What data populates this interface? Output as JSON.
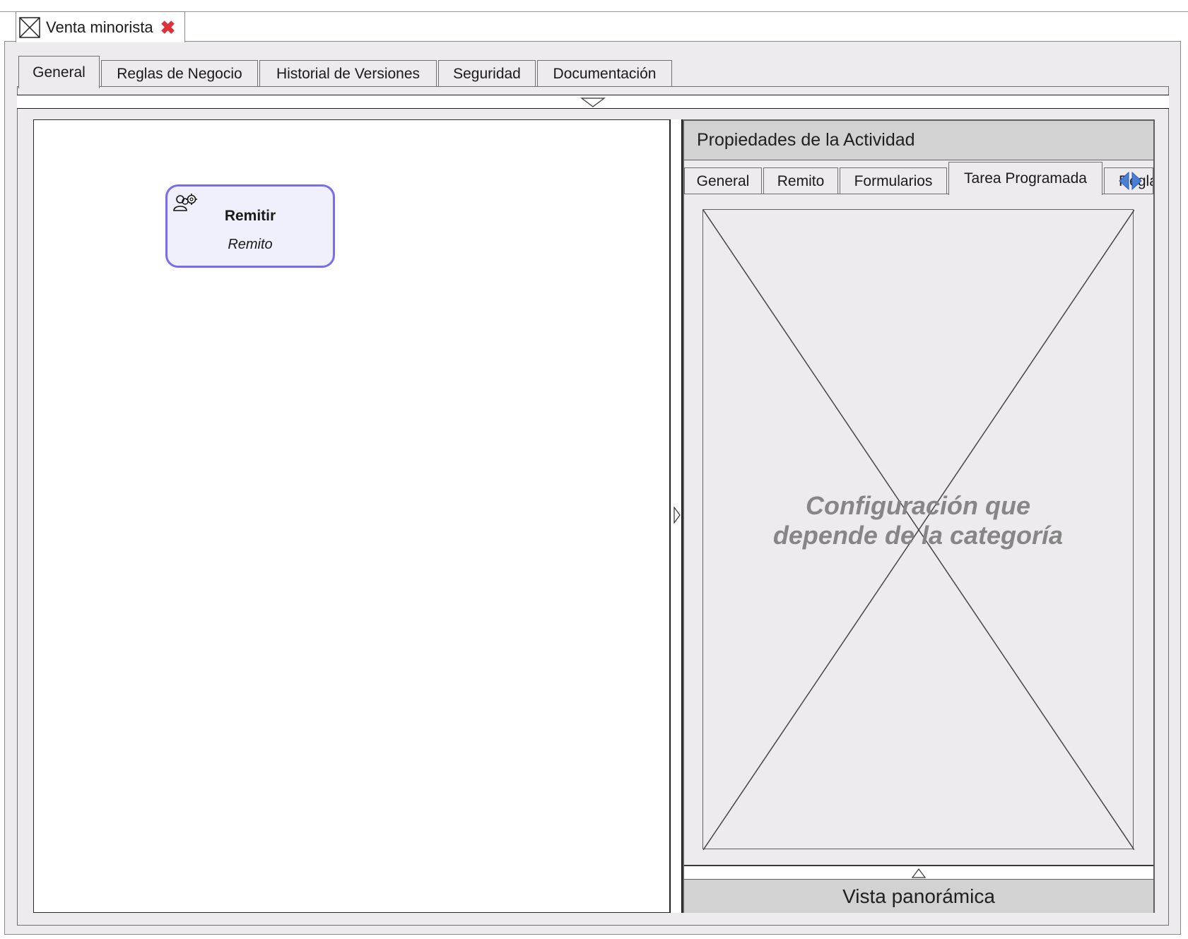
{
  "editor": {
    "tab_title": "Venta minorista",
    "close_glyph": "✖"
  },
  "main_tabs": [
    {
      "label": "General",
      "active": true
    },
    {
      "label": "Reglas de Negocio",
      "active": false
    },
    {
      "label": "Historial de Versiones",
      "active": false
    },
    {
      "label": "Seguridad",
      "active": false
    },
    {
      "label": "Documentación",
      "active": false
    }
  ],
  "activity": {
    "name": "Remitir",
    "subtitle": "Remito",
    "icon": "users-gear-icon",
    "border_color": "#7a6cf0",
    "fill_color": "#eff0fc"
  },
  "properties": {
    "header": "Propiedades de la Actividad",
    "tabs": [
      {
        "label": "General",
        "active": false
      },
      {
        "label": "Remito",
        "active": false
      },
      {
        "label": "Formularios",
        "active": false
      },
      {
        "label": "Tarea Programada",
        "active": true
      },
      {
        "label": "Regla",
        "active": false
      }
    ],
    "placeholder_text_line1": "Configuración que",
    "placeholder_text_line2": "depende de la categoría",
    "footer": "Vista panorámica"
  },
  "colors": {
    "window_bg": "#eeebee",
    "close_red": "#e0303a",
    "arrow_blue": "#4a7fd6"
  }
}
